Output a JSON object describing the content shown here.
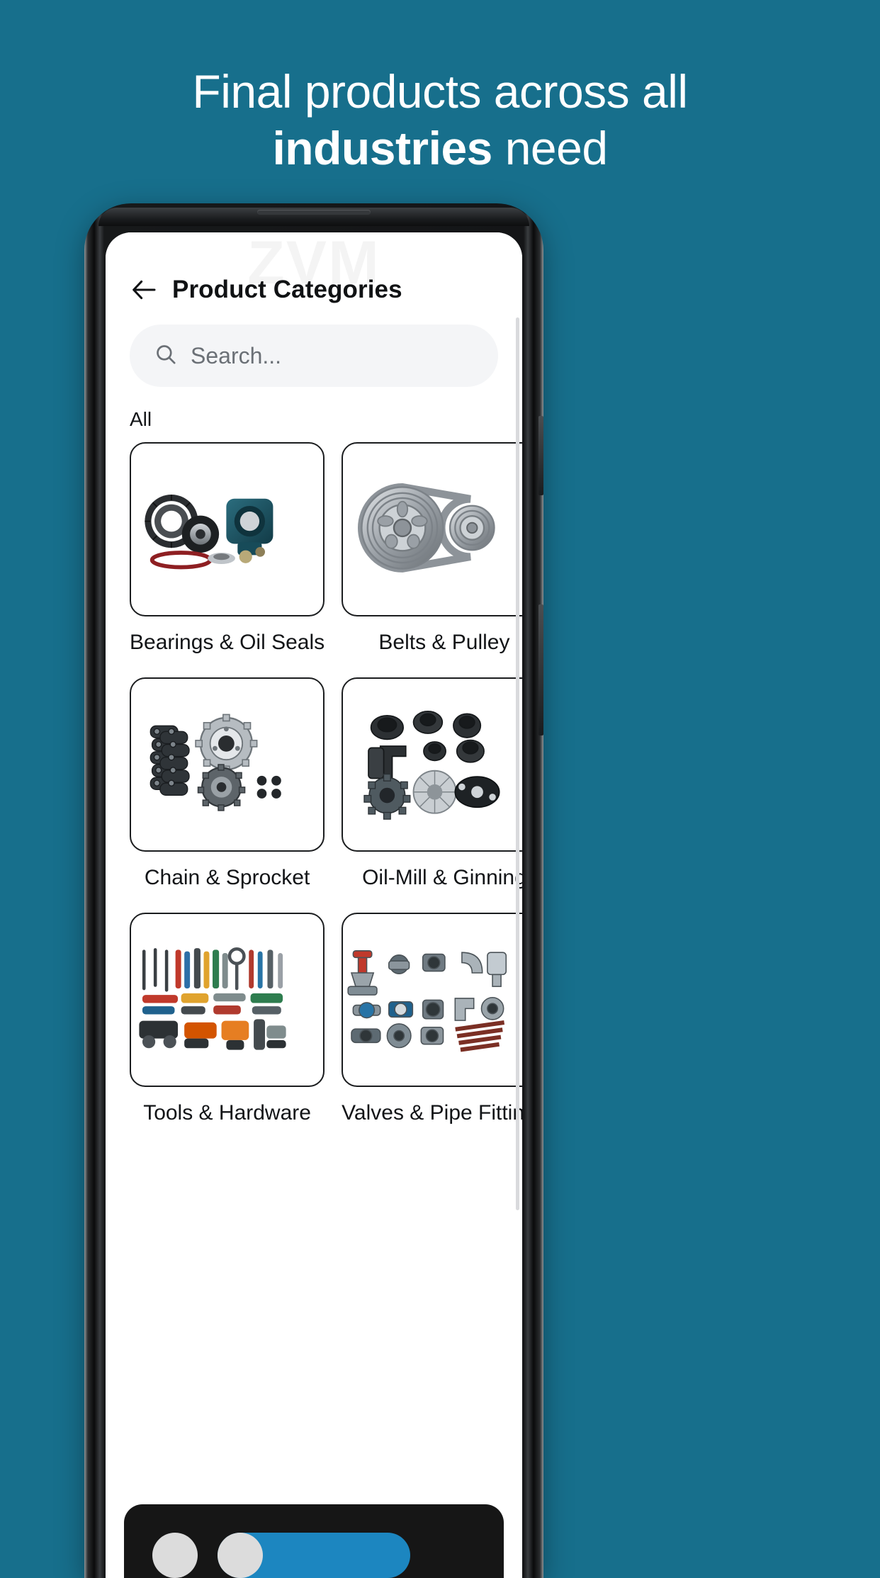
{
  "theme": {
    "background": "#176F8C",
    "accent": "#1C86C0",
    "card_border": "#1B1D1F",
    "text_dark": "#121417",
    "search_bg": "#F4F5F7",
    "sheet_bg": "#161616"
  },
  "promo": {
    "line1": "Final products across all",
    "line2_strong": "industries",
    "line2_rest": " need"
  },
  "app": {
    "watermark": "ZVM",
    "appbar": {
      "back_icon": "arrow-left-icon",
      "title": "Product Categories"
    },
    "search": {
      "icon": "search-icon",
      "placeholder": "Search...",
      "value": ""
    },
    "section_label": "All",
    "categories": [
      {
        "label": "Bearings & Oil Seals",
        "image": "bearings-oil-seals-image"
      },
      {
        "label": "Belts & Pulley",
        "image": "belts-pulley-image"
      },
      {
        "label": "Chain & Sprocket",
        "image": "chain-sprocket-image"
      },
      {
        "label": "Oil-Mill & Ginning",
        "image": "oil-mill-ginning-image"
      },
      {
        "label": "Tools & Hardware",
        "image": "tools-hardware-image"
      },
      {
        "label": "Valves & Pipe Fittings",
        "image": "valves-pipe-fittings-image"
      }
    ]
  }
}
